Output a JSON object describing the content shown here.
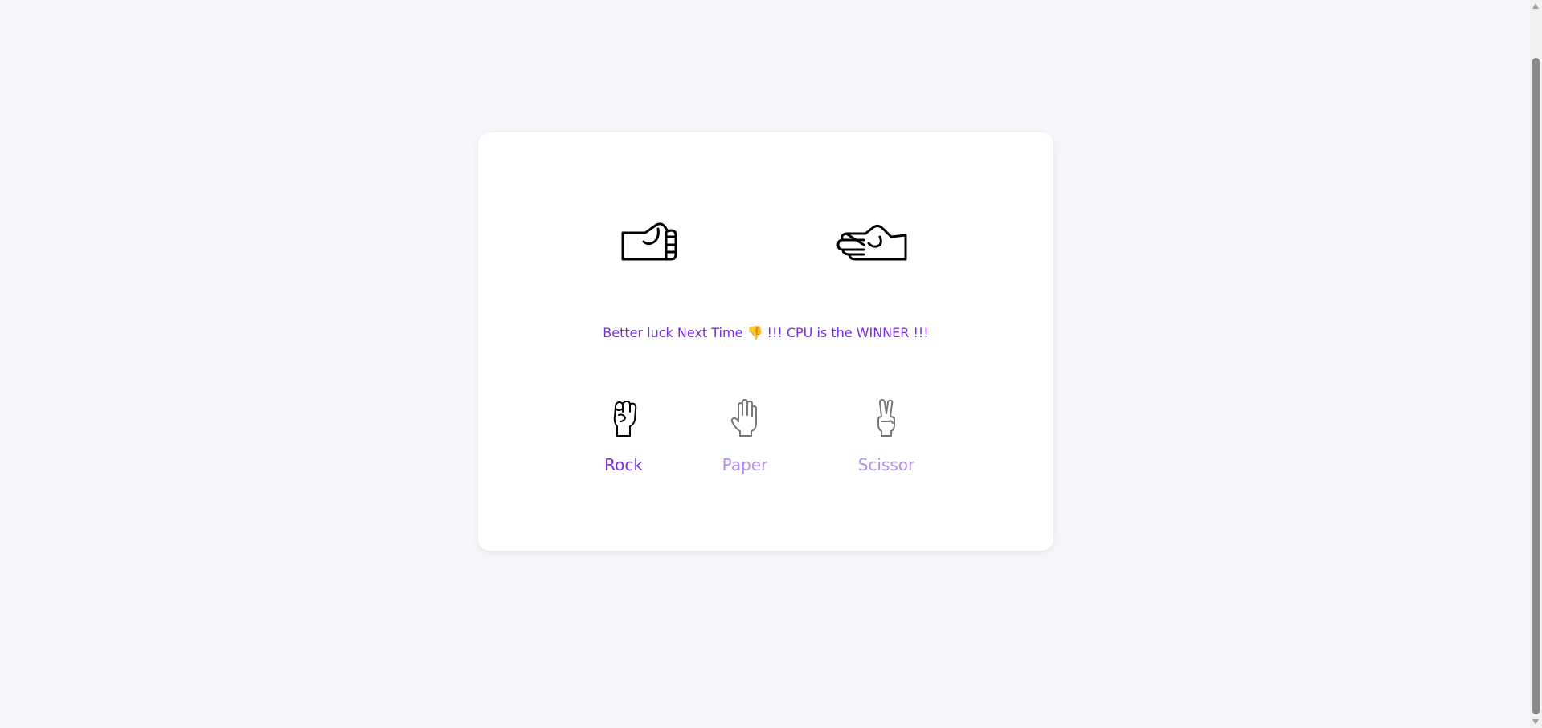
{
  "game": {
    "result_prefix": "Better luck Next Time",
    "result_emoji": "👎",
    "result_suffix": "!!! CPU is the WINNER !!!"
  },
  "choices": [
    {
      "label": "Rock",
      "icon": "rock-hand-icon",
      "selected": true
    },
    {
      "label": "Paper",
      "icon": "paper-hand-icon",
      "selected": false
    },
    {
      "label": "Scissor",
      "icon": "scissor-hand-icon",
      "selected": false
    }
  ],
  "display": {
    "player_hand": "rock-fist-icon",
    "cpu_hand": "paper-hand-sideways-icon"
  },
  "colors": {
    "accent": "#7b2ee0",
    "accent_light": "#b38ef0",
    "background": "#f5f6fa",
    "card": "#ffffff"
  }
}
